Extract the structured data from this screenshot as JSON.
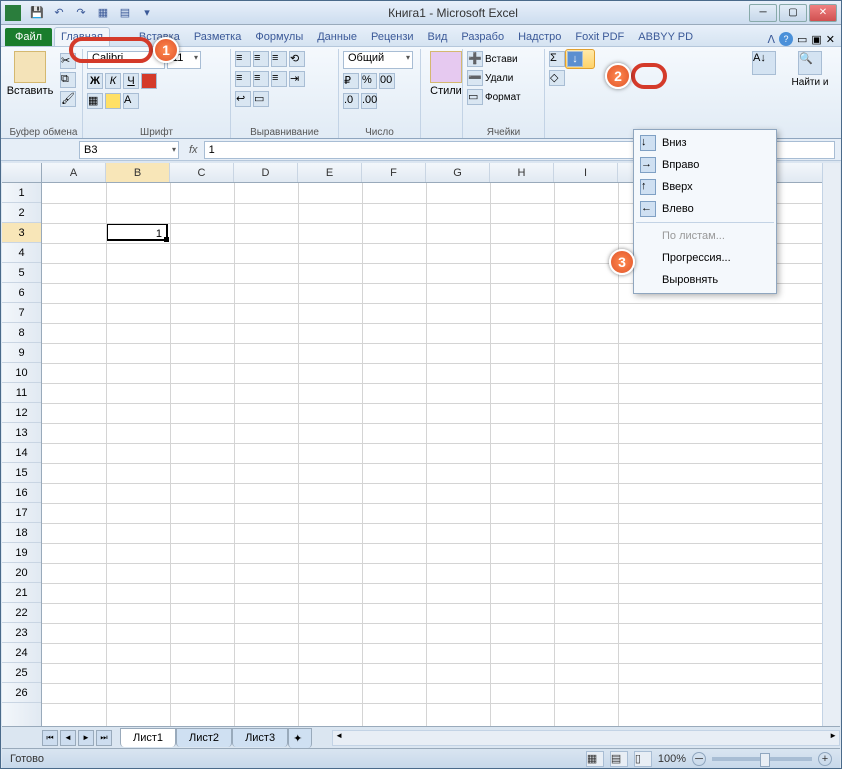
{
  "title": "Книга1 - Microsoft Excel",
  "qat_icons": [
    "save",
    "undo",
    "redo",
    "new",
    "open",
    "dropdown"
  ],
  "win": {
    "min": "─",
    "max": "▢",
    "close": "✕"
  },
  "tabs": {
    "file": "Файл",
    "list": [
      "Главная",
      "Вставка",
      "Разметка",
      "Формулы",
      "Данные",
      "Рецензи",
      "Вид",
      "Разрабо",
      "Надстро",
      "Foxit PDF",
      "ABBYY PD"
    ],
    "active_index": 0
  },
  "ribbon": {
    "clipboard": {
      "label": "Буфер обмена",
      "paste": "Вставить"
    },
    "font": {
      "label": "Шрифт",
      "name": "Calibri",
      "size": "11",
      "buttons": [
        "Ж",
        "К",
        "Ч"
      ]
    },
    "align": {
      "label": "Выравнивание"
    },
    "number": {
      "label": "Число",
      "format": "Общий"
    },
    "styles": {
      "label": "Стили"
    },
    "cells": {
      "label": "Ячейки",
      "insert": "Встави",
      "delete": "Удали",
      "format": "Формат"
    },
    "editing": {
      "find": "Найти и"
    }
  },
  "formula": {
    "namebox": "B3",
    "fx": "fx",
    "value": "1"
  },
  "grid": {
    "cols": [
      "A",
      "B",
      "C",
      "D",
      "E",
      "F",
      "G",
      "H",
      "I"
    ],
    "sel_col": 1,
    "rows": 26,
    "sel_row": 3,
    "active_value": "1"
  },
  "fill_menu": {
    "items": [
      {
        "label": "Вниз",
        "u": "В"
      },
      {
        "label": "Вправо",
        "u": "п"
      },
      {
        "label": "Вверх",
        "u": "в"
      },
      {
        "label": "Влево",
        "u": "л"
      },
      {
        "label": "По листам...",
        "disabled": true
      },
      {
        "label": "Прогрессия...",
        "u": "П"
      },
      {
        "label": "Выровнять",
        "u": "ы"
      }
    ]
  },
  "sheets": {
    "active": "Лист1",
    "others": [
      "Лист2",
      "Лист3"
    ]
  },
  "status": {
    "ready": "Готово",
    "zoom": "100%",
    "minus": "─",
    "plus": "+"
  },
  "annotations": {
    "b1": "1",
    "b2": "2",
    "b3": "3"
  }
}
